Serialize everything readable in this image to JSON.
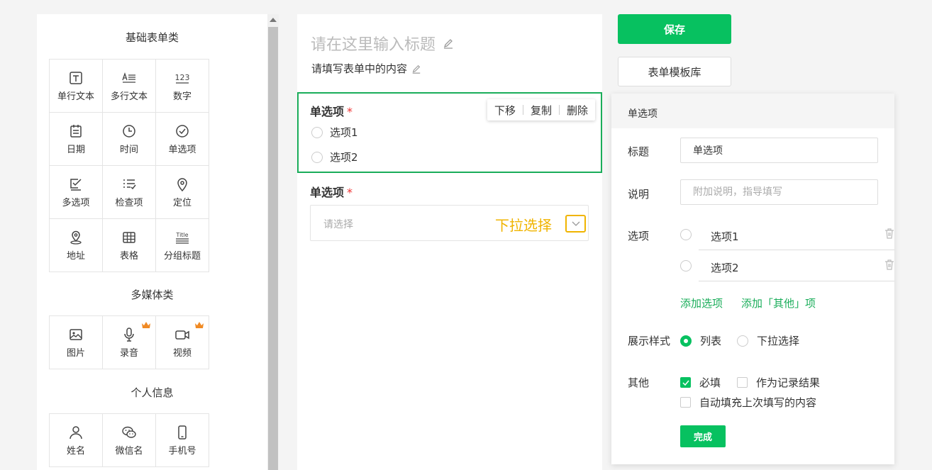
{
  "palette": {
    "basic": {
      "title": "基础表单类",
      "items": [
        {
          "label": "单行文本",
          "icon": "single-line-text-icon"
        },
        {
          "label": "多行文本",
          "icon": "multi-line-text-icon"
        },
        {
          "label": "数字",
          "icon": "number-icon",
          "glyph": "123"
        },
        {
          "label": "日期",
          "icon": "calendar-icon"
        },
        {
          "label": "时间",
          "icon": "clock-icon"
        },
        {
          "label": "单选项",
          "icon": "check-circle-icon"
        },
        {
          "label": "多选项",
          "icon": "checkbox-icon"
        },
        {
          "label": "检查项",
          "icon": "checklist-icon"
        },
        {
          "label": "定位",
          "icon": "location-pin-icon"
        },
        {
          "label": "地址",
          "icon": "address-pin-icon"
        },
        {
          "label": "表格",
          "icon": "table-icon"
        },
        {
          "label": "分组标题",
          "icon": "title-icon",
          "glyph": "Title"
        }
      ]
    },
    "media": {
      "title": "多媒体类",
      "items": [
        {
          "label": "图片",
          "icon": "image-icon"
        },
        {
          "label": "录音",
          "icon": "microphone-icon",
          "premium": true
        },
        {
          "label": "视频",
          "icon": "video-icon",
          "premium": true
        }
      ]
    },
    "personal": {
      "title": "个人信息",
      "items": [
        {
          "label": "姓名",
          "icon": "person-icon"
        },
        {
          "label": "微信名",
          "icon": "wechat-icon"
        },
        {
          "label": "手机号",
          "icon": "phone-icon"
        }
      ]
    }
  },
  "canvas": {
    "title_placeholder": "请在这里输入标题",
    "description": "请填写表单中的内容",
    "question1": {
      "title": "单选项",
      "required_mark": "*",
      "options": [
        "选项1",
        "选项2"
      ],
      "toolbar": {
        "move_down": "下移",
        "copy": "复制",
        "delete": "删除"
      }
    },
    "question2": {
      "title": "单选项",
      "required_mark": "*",
      "placeholder": "请选择",
      "dropdown_label": "下拉选择"
    }
  },
  "actions": {
    "save": "保存",
    "template_library": "表单模板库"
  },
  "properties": {
    "header": "单选项",
    "title_label": "标题",
    "title_value": "单选项",
    "desc_label": "说明",
    "desc_placeholder": "附加说明，指导填写",
    "options_label": "选项",
    "options": [
      "选项1",
      "选项2"
    ],
    "add_option": "添加选项",
    "add_other": "添加「其他」项",
    "display_label": "展示样式",
    "display_list": "列表",
    "display_dropdown": "下拉选择",
    "other_label": "其他",
    "required": "必填",
    "as_record_result": "作为记录结果",
    "autofill": "自动填充上次填写的内容",
    "done": "完成"
  },
  "colors": {
    "accent_green": "#07c160",
    "selected_border": "#1aad5a",
    "highlight_yellow": "#f0b400",
    "crown_orange": "#f08a24"
  }
}
